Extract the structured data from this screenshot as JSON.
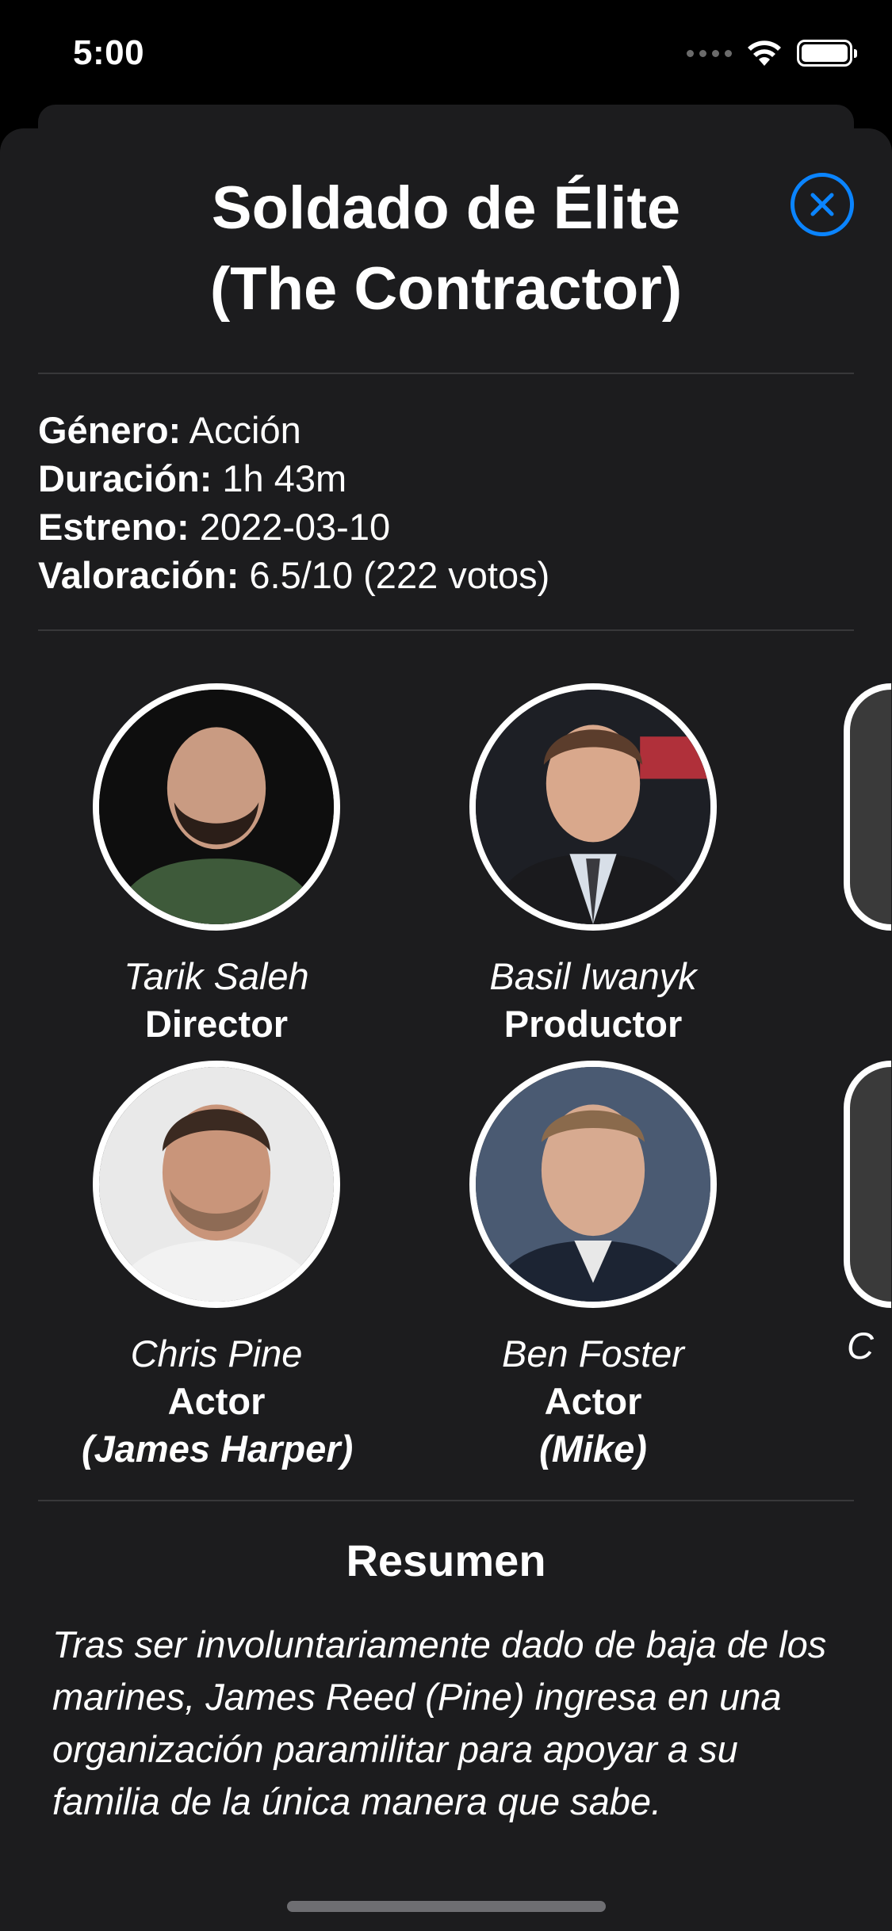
{
  "status_bar": {
    "time": "5:00"
  },
  "movie": {
    "title_line1": "Soldado de Élite",
    "title_line2": "(The Contractor)"
  },
  "info": {
    "genre_label": "Género:",
    "genre_value": " Acción",
    "duration_label": "Duración:",
    "duration_value": " 1h 43m",
    "release_label": "Estreno:",
    "release_value": " 2022-03-10",
    "rating_label": "Valoración:",
    "rating_value": " 6.5/10 (222 votos)"
  },
  "crew": [
    {
      "name": "Tarik Saleh",
      "role": "Director"
    },
    {
      "name": "Basil Iwanyk",
      "role": "Productor"
    }
  ],
  "cast": [
    {
      "name": "Chris Pine",
      "role": "Actor",
      "character": "(James Harper)"
    },
    {
      "name": "Ben Foster",
      "role": "Actor",
      "character": "(Mike)"
    }
  ],
  "partial_cast_letter": "C",
  "summary": {
    "heading": "Resumen",
    "text": "Tras ser involuntariamente dado de baja de los marines, James Reed (Pine) ingresa en una organización paramilitar para apoyar a su familia de la única manera que sabe."
  },
  "colors": {
    "accent": "#0a84ff",
    "sheet_background": "#1c1c1e",
    "divider": "#38383a"
  }
}
